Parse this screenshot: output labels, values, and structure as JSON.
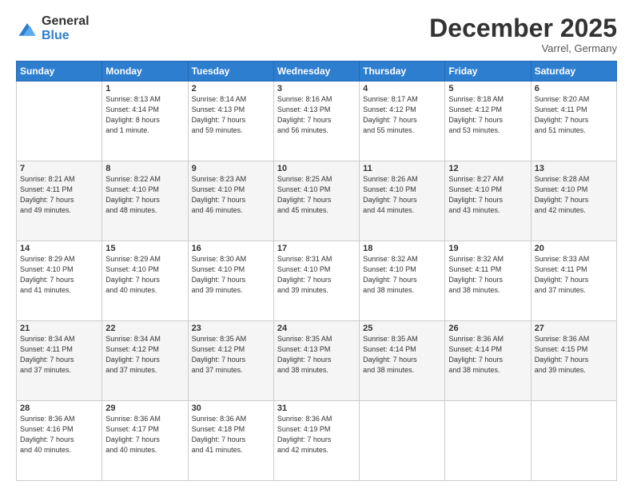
{
  "logo": {
    "general": "General",
    "blue": "Blue"
  },
  "header": {
    "month": "December 2025",
    "location": "Varrel, Germany"
  },
  "days": [
    "Sunday",
    "Monday",
    "Tuesday",
    "Wednesday",
    "Thursday",
    "Friday",
    "Saturday"
  ],
  "weeks": [
    [
      {
        "day": "",
        "info": ""
      },
      {
        "day": "1",
        "info": "Sunrise: 8:13 AM\nSunset: 4:14 PM\nDaylight: 8 hours\nand 1 minute."
      },
      {
        "day": "2",
        "info": "Sunrise: 8:14 AM\nSunset: 4:13 PM\nDaylight: 7 hours\nand 59 minutes."
      },
      {
        "day": "3",
        "info": "Sunrise: 8:16 AM\nSunset: 4:13 PM\nDaylight: 7 hours\nand 56 minutes."
      },
      {
        "day": "4",
        "info": "Sunrise: 8:17 AM\nSunset: 4:12 PM\nDaylight: 7 hours\nand 55 minutes."
      },
      {
        "day": "5",
        "info": "Sunrise: 8:18 AM\nSunset: 4:12 PM\nDaylight: 7 hours\nand 53 minutes."
      },
      {
        "day": "6",
        "info": "Sunrise: 8:20 AM\nSunset: 4:11 PM\nDaylight: 7 hours\nand 51 minutes."
      }
    ],
    [
      {
        "day": "7",
        "info": "Sunrise: 8:21 AM\nSunset: 4:11 PM\nDaylight: 7 hours\nand 49 minutes."
      },
      {
        "day": "8",
        "info": "Sunrise: 8:22 AM\nSunset: 4:10 PM\nDaylight: 7 hours\nand 48 minutes."
      },
      {
        "day": "9",
        "info": "Sunrise: 8:23 AM\nSunset: 4:10 PM\nDaylight: 7 hours\nand 46 minutes."
      },
      {
        "day": "10",
        "info": "Sunrise: 8:25 AM\nSunset: 4:10 PM\nDaylight: 7 hours\nand 45 minutes."
      },
      {
        "day": "11",
        "info": "Sunrise: 8:26 AM\nSunset: 4:10 PM\nDaylight: 7 hours\nand 44 minutes."
      },
      {
        "day": "12",
        "info": "Sunrise: 8:27 AM\nSunset: 4:10 PM\nDaylight: 7 hours\nand 43 minutes."
      },
      {
        "day": "13",
        "info": "Sunrise: 8:28 AM\nSunset: 4:10 PM\nDaylight: 7 hours\nand 42 minutes."
      }
    ],
    [
      {
        "day": "14",
        "info": "Sunrise: 8:29 AM\nSunset: 4:10 PM\nDaylight: 7 hours\nand 41 minutes."
      },
      {
        "day": "15",
        "info": "Sunrise: 8:29 AM\nSunset: 4:10 PM\nDaylight: 7 hours\nand 40 minutes."
      },
      {
        "day": "16",
        "info": "Sunrise: 8:30 AM\nSunset: 4:10 PM\nDaylight: 7 hours\nand 39 minutes."
      },
      {
        "day": "17",
        "info": "Sunrise: 8:31 AM\nSunset: 4:10 PM\nDaylight: 7 hours\nand 39 minutes."
      },
      {
        "day": "18",
        "info": "Sunrise: 8:32 AM\nSunset: 4:10 PM\nDaylight: 7 hours\nand 38 minutes."
      },
      {
        "day": "19",
        "info": "Sunrise: 8:32 AM\nSunset: 4:11 PM\nDaylight: 7 hours\nand 38 minutes."
      },
      {
        "day": "20",
        "info": "Sunrise: 8:33 AM\nSunset: 4:11 PM\nDaylight: 7 hours\nand 37 minutes."
      }
    ],
    [
      {
        "day": "21",
        "info": "Sunrise: 8:34 AM\nSunset: 4:11 PM\nDaylight: 7 hours\nand 37 minutes."
      },
      {
        "day": "22",
        "info": "Sunrise: 8:34 AM\nSunset: 4:12 PM\nDaylight: 7 hours\nand 37 minutes."
      },
      {
        "day": "23",
        "info": "Sunrise: 8:35 AM\nSunset: 4:12 PM\nDaylight: 7 hours\nand 37 minutes."
      },
      {
        "day": "24",
        "info": "Sunrise: 8:35 AM\nSunset: 4:13 PM\nDaylight: 7 hours\nand 38 minutes."
      },
      {
        "day": "25",
        "info": "Sunrise: 8:35 AM\nSunset: 4:14 PM\nDaylight: 7 hours\nand 38 minutes."
      },
      {
        "day": "26",
        "info": "Sunrise: 8:36 AM\nSunset: 4:14 PM\nDaylight: 7 hours\nand 38 minutes."
      },
      {
        "day": "27",
        "info": "Sunrise: 8:36 AM\nSunset: 4:15 PM\nDaylight: 7 hours\nand 39 minutes."
      }
    ],
    [
      {
        "day": "28",
        "info": "Sunrise: 8:36 AM\nSunset: 4:16 PM\nDaylight: 7 hours\nand 40 minutes."
      },
      {
        "day": "29",
        "info": "Sunrise: 8:36 AM\nSunset: 4:17 PM\nDaylight: 7 hours\nand 40 minutes."
      },
      {
        "day": "30",
        "info": "Sunrise: 8:36 AM\nSunset: 4:18 PM\nDaylight: 7 hours\nand 41 minutes."
      },
      {
        "day": "31",
        "info": "Sunrise: 8:36 AM\nSunset: 4:19 PM\nDaylight: 7 hours\nand 42 minutes."
      },
      {
        "day": "",
        "info": ""
      },
      {
        "day": "",
        "info": ""
      },
      {
        "day": "",
        "info": ""
      }
    ]
  ]
}
